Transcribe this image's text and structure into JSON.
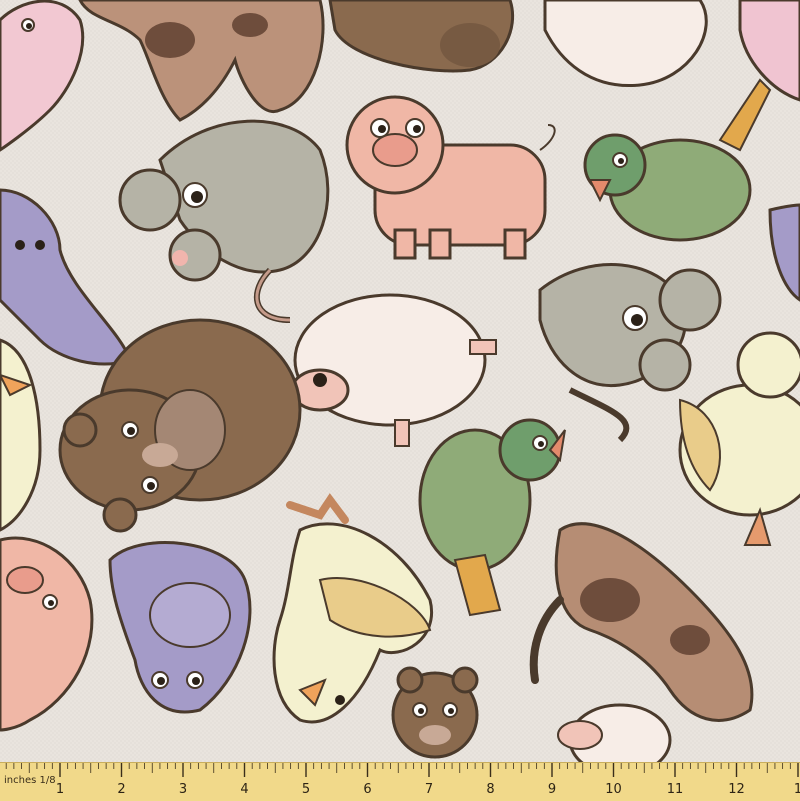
{
  "image": {
    "subject": "fabric print",
    "pattern": "cartoon farm animals on beige fabric",
    "colors": {
      "background": "#e9e4de",
      "outline": "#4a3a2c",
      "pig": "#f0b7a6",
      "mouse": "#b5b3a6",
      "bear": "#8a6a4e",
      "sheep": "#f7ede7",
      "parrot": "#8fab78",
      "duck": "#f4f1cf",
      "cat": "#a49bc8",
      "cow": "#b68d74",
      "ruler": "#f1d98a"
    }
  },
  "ruler": {
    "unit_label": "inches 1/8",
    "ticks": [
      "1",
      "2",
      "3",
      "4",
      "5",
      "6",
      "7",
      "8",
      "9",
      "10",
      "11",
      "12",
      "1"
    ]
  }
}
